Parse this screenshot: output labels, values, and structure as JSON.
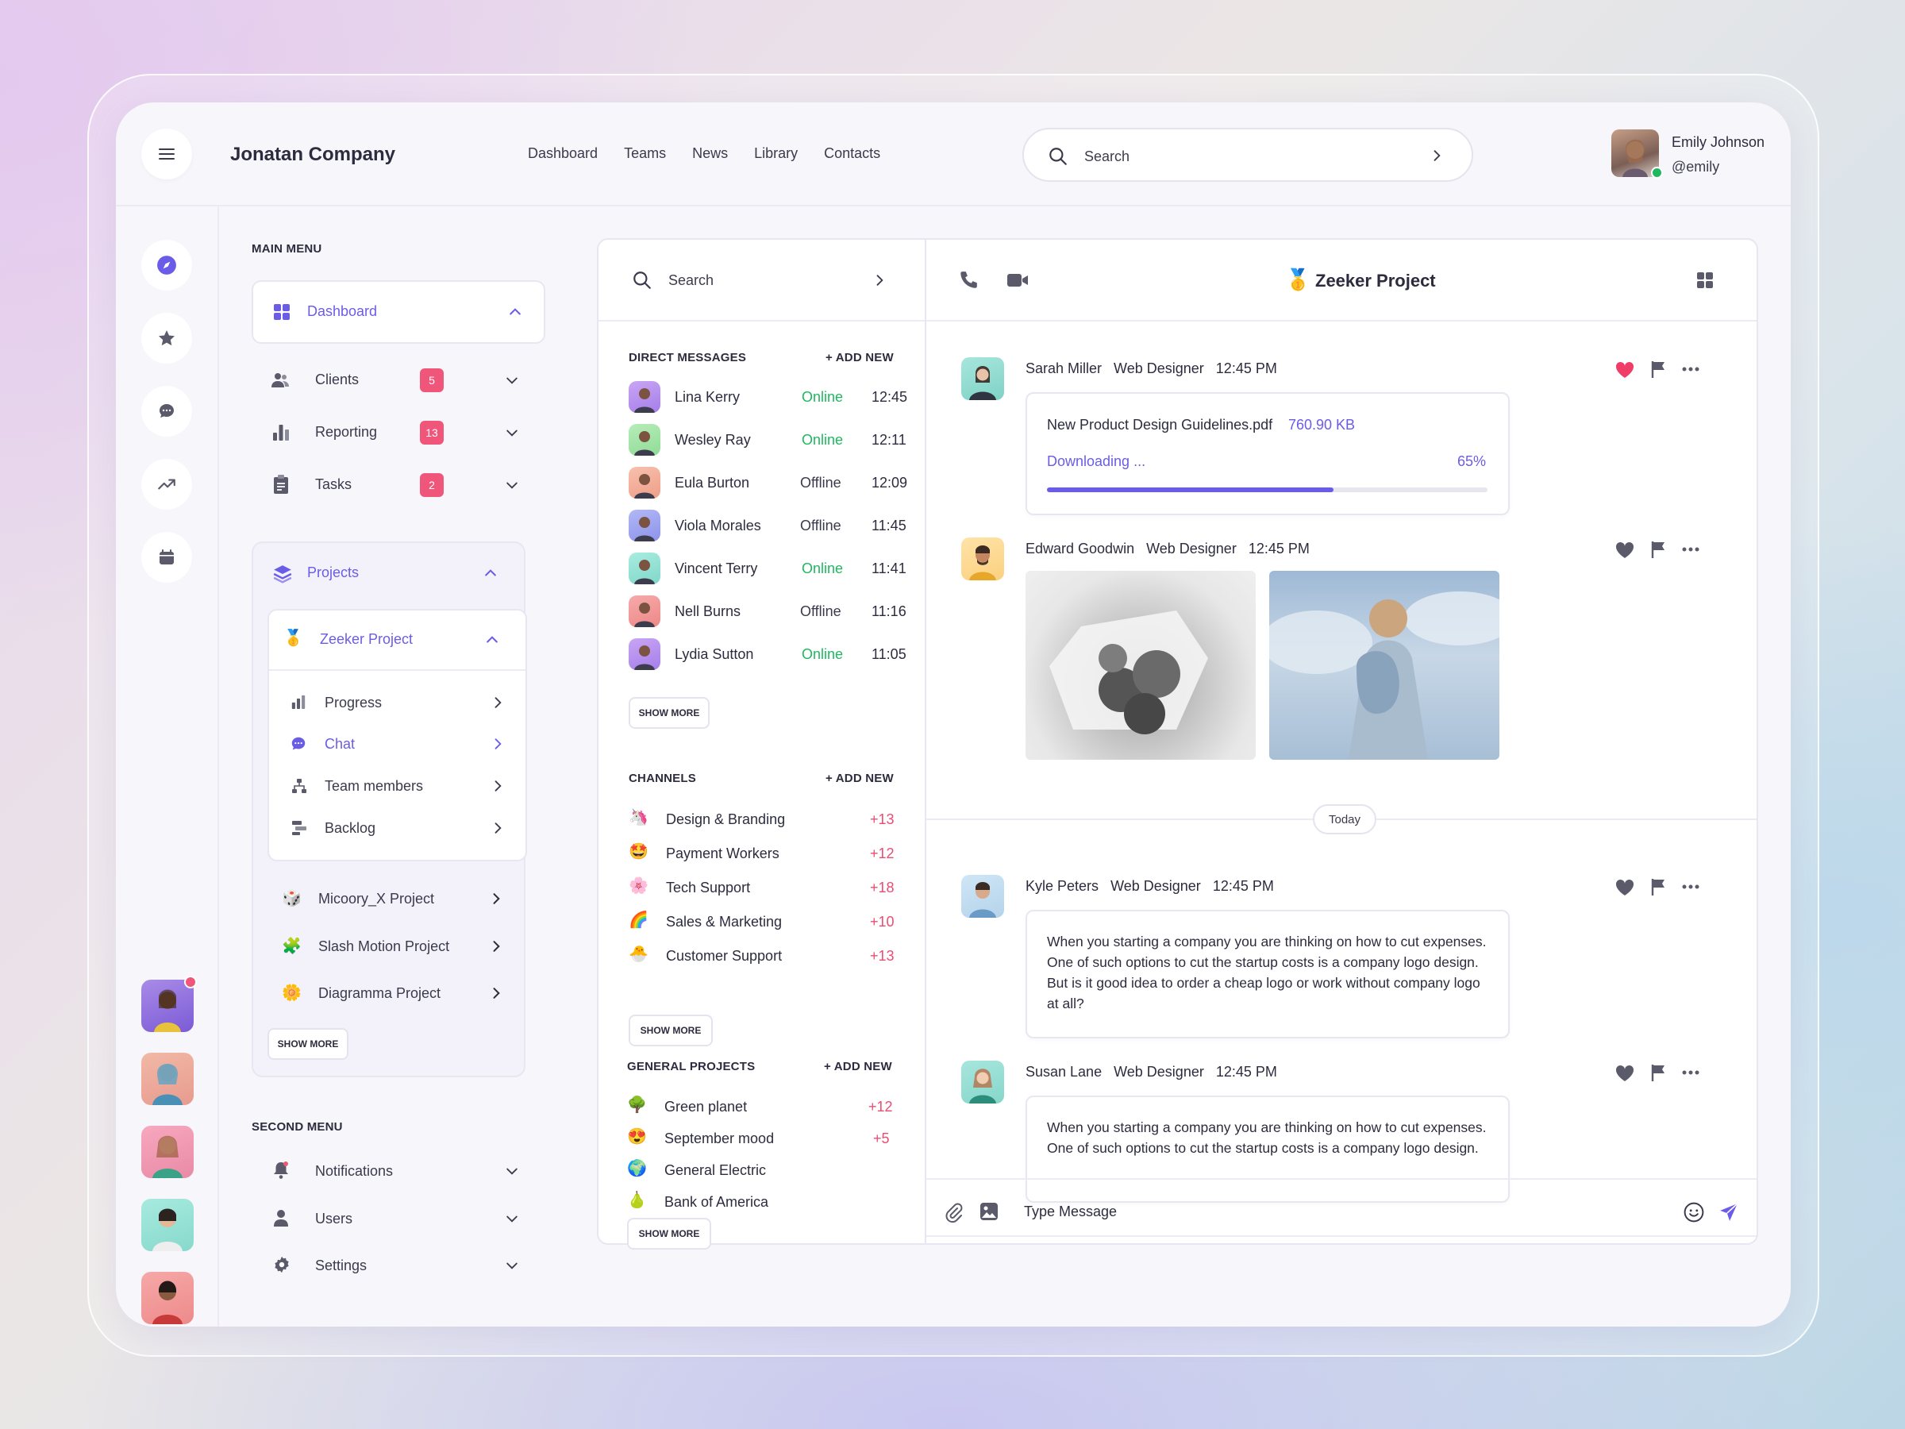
{
  "header": {
    "company": "Jonatan Company",
    "nav": [
      "Dashboard",
      "Teams",
      "News",
      "Library",
      "Contacts"
    ],
    "search_placeholder": "Search",
    "user": {
      "name": "Emily Johnson",
      "handle": "@emily"
    }
  },
  "main_menu": {
    "title": "MAIN MENU",
    "dashboard": "Dashboard",
    "items": [
      {
        "label": "Clients",
        "badge": "5"
      },
      {
        "label": "Reporting",
        "badge": "13"
      },
      {
        "label": "Tasks",
        "badge": "2"
      }
    ],
    "projects": {
      "label": "Projects",
      "active": "Zeeker Project",
      "sub": [
        "Progress",
        "Chat",
        "Team members",
        "Backlog"
      ],
      "others": [
        "Micoory_X Project",
        "Slash Motion Project",
        "Diagramma Project"
      ],
      "show_more": "SHOW MORE"
    }
  },
  "second_menu": {
    "title": "SECOND MENU",
    "items": [
      "Notifications",
      "Users",
      "Settings"
    ]
  },
  "messages_panel": {
    "search_placeholder": "Search",
    "direct": {
      "title": "DIRECT MESSAGES",
      "add": "+ ADD NEW",
      "items": [
        {
          "name": "Lina Kerry",
          "status": "Online",
          "time": "12:45"
        },
        {
          "name": "Wesley Ray",
          "status": "Online",
          "time": "12:11"
        },
        {
          "name": "Eula Burton",
          "status": "Offline",
          "time": "12:09"
        },
        {
          "name": "Viola Morales",
          "status": "Offline",
          "time": "11:45"
        },
        {
          "name": "Vincent Terry",
          "status": "Online",
          "time": "11:41"
        },
        {
          "name": "Nell Burns",
          "status": "Offline",
          "time": "11:16"
        },
        {
          "name": "Lydia Sutton",
          "status": "Online",
          "time": "11:05"
        }
      ],
      "show_more": "SHOW MORE"
    },
    "channels": {
      "title": "CHANNELS",
      "add": "+ ADD NEW",
      "items": [
        {
          "emoji": "🦄",
          "name": "Design & Branding",
          "count": "+13"
        },
        {
          "emoji": "🤩",
          "name": "Payment Workers",
          "count": "+12"
        },
        {
          "emoji": "🌸",
          "name": "Tech Support",
          "count": "+18"
        },
        {
          "emoji": "🌈",
          "name": "Sales & Marketing",
          "count": "+10"
        },
        {
          "emoji": "🐣",
          "name": "Customer Support",
          "count": "+13"
        }
      ],
      "show_more": "SHOW MORE"
    },
    "general": {
      "title": "GENERAL PROJECTS",
      "add": "+ ADD NEW",
      "items": [
        {
          "emoji": "🌳",
          "name": "Green planet",
          "count": "+12"
        },
        {
          "emoji": "😍",
          "name": "September mood",
          "count": "+5"
        },
        {
          "emoji": "🌍",
          "name": "General Electric",
          "count": ""
        },
        {
          "emoji": "🍐",
          "name": "Bank of America",
          "count": ""
        }
      ],
      "show_more": "SHOW MORE"
    }
  },
  "chat": {
    "title": "Zeeker Project",
    "title_emoji": "🥇",
    "messages": [
      {
        "name": "Sarah Miller",
        "role": "Web Designer",
        "time": "12:45 PM",
        "liked": true,
        "file": {
          "name": "New Product Design Guidelines.pdf",
          "size": "760.90 KB",
          "status": "Downloading ...",
          "progress_label": "65%",
          "progress": 0.65
        }
      },
      {
        "name": "Edward Goodwin",
        "role": "Web Designer",
        "time": "12:45 PM",
        "liked": false
      }
    ],
    "divider": "Today",
    "messages_today": [
      {
        "name": "Kyle Peters",
        "role": "Web Designer",
        "time": "12:45 PM",
        "text": "When you starting a company you are thinking on how to cut expenses. One of such options to cut the startup costs is a company logo design. But is it good idea to order a cheap logo or work without company logo at all?"
      },
      {
        "name": "Susan Lane",
        "role": "Web Designer",
        "time": "12:45 PM",
        "text": "When you starting a company you are thinking on how to cut expenses. One of such options to cut the startup costs is a company logo design."
      }
    ],
    "input_placeholder": "Type Message"
  },
  "colors": {
    "accent": "#6b5ce7",
    "online": "#1fb75f",
    "badge": "#f0557a",
    "heart": "#ef3d68"
  }
}
